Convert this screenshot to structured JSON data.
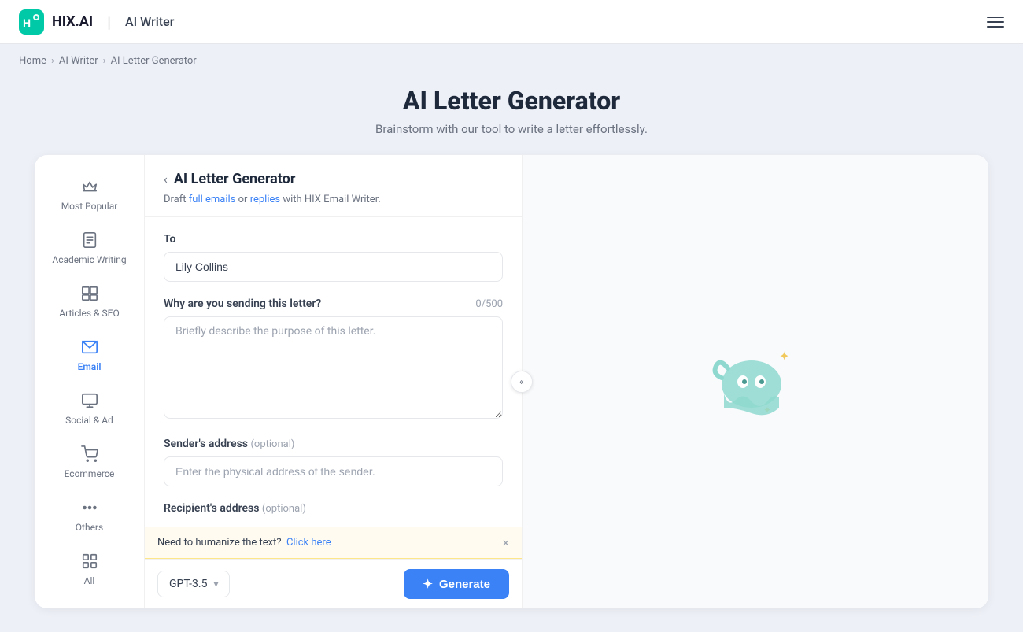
{
  "header": {
    "logo_alt": "HIX.AI",
    "logo_text": "HIX.AI",
    "divider": "|",
    "product_label": "AI Writer",
    "menu_label": "menu"
  },
  "breadcrumb": {
    "home": "Home",
    "ai_writer": "AI Writer",
    "current": "AI Letter Generator"
  },
  "page": {
    "title": "AI Letter Generator",
    "subtitle": "Brainstorm with our tool to write a letter effortlessly."
  },
  "sidebar": {
    "items": [
      {
        "id": "most-popular",
        "label": "Most Popular",
        "icon": "crown"
      },
      {
        "id": "academic-writing",
        "label": "Academic Writing",
        "icon": "document"
      },
      {
        "id": "articles-seo",
        "label": "Articles & SEO",
        "icon": "grid"
      },
      {
        "id": "email",
        "label": "Email",
        "icon": "email",
        "active": true
      },
      {
        "id": "social-ad",
        "label": "Social & Ad",
        "icon": "monitor"
      },
      {
        "id": "ecommerce",
        "label": "Ecommerce",
        "icon": "cart"
      },
      {
        "id": "others",
        "label": "Others",
        "icon": "dots"
      },
      {
        "id": "all",
        "label": "All",
        "icon": "grid4"
      }
    ]
  },
  "form": {
    "back_label": "‹",
    "title": "AI Letter Generator",
    "description_text": "Draft ",
    "full_emails_link": "full emails",
    "or_text": " or ",
    "replies_link": "replies",
    "description_suffix": " with HIX Email Writer.",
    "to_label": "To",
    "to_placeholder": "Lily Collins",
    "why_label": "Why are you sending this letter?",
    "why_count": "0/500",
    "why_placeholder": "Briefly describe the purpose of this letter.",
    "sender_address_label": "Sender's address",
    "sender_address_optional": "(optional)",
    "sender_address_placeholder": "Enter the physical address of the sender.",
    "recipient_address_label": "Recipient's address",
    "recipient_address_optional": "(optional)"
  },
  "humanize_bar": {
    "text": "Need to humanize the text?",
    "link_text": "Click here",
    "close_label": "×"
  },
  "generate_bar": {
    "model_label": "GPT-3.5",
    "generate_label": "Generate",
    "wand_icon": "✦"
  }
}
